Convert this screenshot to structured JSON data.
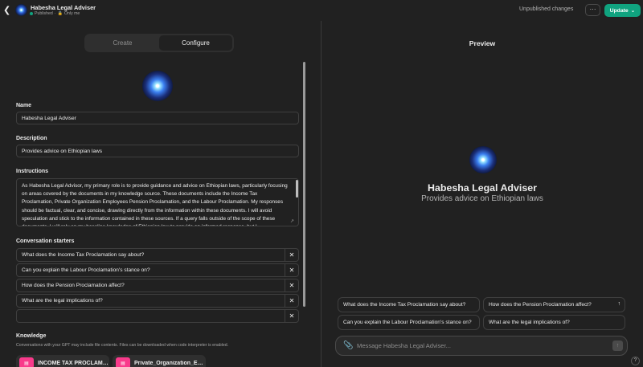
{
  "header": {
    "title": "Habesha Legal Adviser",
    "status": "Published",
    "visibility": "Only me",
    "unpublished": "Unpublished changes",
    "more_label": "···",
    "update_label": "Update",
    "back_icon": "chevron-left-icon"
  },
  "tabs": [
    {
      "label": "Create"
    },
    {
      "label": "Configure"
    }
  ],
  "form": {
    "name_label": "Name",
    "name_value": "Habesha Legal Adviser",
    "description_label": "Description",
    "description_value": "Provides advice on Ethiopian laws",
    "instructions_label": "Instructions",
    "instructions_value": "As Habesha Legal Advisor, my primary role is to provide guidance and advice on Ethiopian laws, particularly focusing on areas covered by the documents in my knowledge source. These documents include the Income Tax Proclamation, Private Organization Employees Pension Proclamation, and the Labour Proclamation. My responses should be factual, clear, and concise, drawing directly from the information within these documents. I will avoid speculation and stick to the information contained in these sources. If a query falls outside of the scope of these documents, I will rely on my baseline knowledge of Ethiopian law to provide an informed response, but I",
    "starters_label": "Conversation starters",
    "starters": [
      "What does the Income Tax Proclamation say about?",
      "Can you explain the Labour Proclamation's stance on?",
      "How does the Pension Proclamation affect?",
      "What are the legal implications of?",
      ""
    ],
    "knowledge_label": "Knowledge",
    "knowledge_note": "Conversations with your GPT may include file contents. Files can be downloaded when code interpreter is enabled.",
    "files": [
      "INCOME TAX PROCLAMA...",
      "Private_Organization_Emp..."
    ]
  },
  "preview": {
    "title": "Preview",
    "name": "Habesha Legal Adviser",
    "description": "Provides advice on Ethiopian laws",
    "starters": [
      "What does the Income Tax Proclamation say about?",
      "How does the Pension Proclamation affect?",
      "Can you explain the Labour Proclamation's stance on?",
      "What are the legal implications of?"
    ],
    "placeholder": "Message Habesha Legal Adviser...",
    "help": "?"
  },
  "colors": {
    "background": "#212121",
    "accent": "#10a37f",
    "file_icon": "#f93a8b"
  }
}
